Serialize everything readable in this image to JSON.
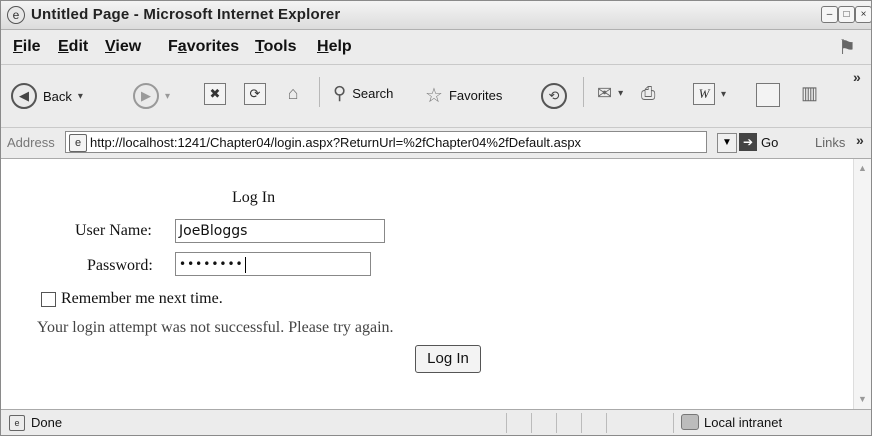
{
  "window": {
    "title": "Untitled Page - Microsoft Internet Explorer",
    "controls": [
      "–",
      "□",
      "×"
    ]
  },
  "menu": {
    "items": [
      {
        "label": "File",
        "underline": "F"
      },
      {
        "label": "Edit",
        "underline": "E"
      },
      {
        "label": "View",
        "underline": "V"
      },
      {
        "label": "Favorites",
        "underline": "a"
      },
      {
        "label": "Tools",
        "underline": "T"
      },
      {
        "label": "Help",
        "underline": "H"
      }
    ]
  },
  "toolbar": {
    "back_label": "Back",
    "search_label": "Search",
    "favorites_label": "Favorites",
    "overflow": "»"
  },
  "address": {
    "label": "Address",
    "url": "http://localhost:1241/Chapter04/login.aspx?ReturnUrl=%2fChapter04%2fDefault.aspx",
    "go_label": "Go",
    "links_label": "Links",
    "links_overflow": "»"
  },
  "login": {
    "title": "Log In",
    "username_label": "User Name:",
    "username_value": "JoeBloggs",
    "password_label": "Password:",
    "password_masked": "••••••••",
    "remember_label": "Remember me next time.",
    "remember_checked": false,
    "error_message": "Your login attempt was not successful. Please try again.",
    "error_color": "#444444",
    "submit_label": "Log In"
  },
  "status": {
    "text": "Done",
    "zone": "Local intranet"
  }
}
